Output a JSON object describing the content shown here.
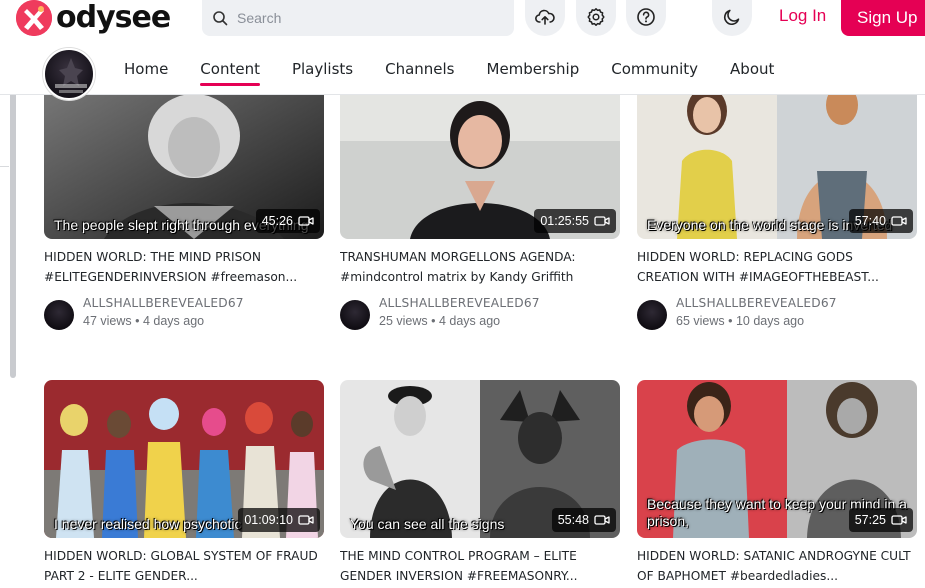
{
  "header": {
    "logo_text": "odysee",
    "search_placeholder": "Search",
    "login_label": "Log In",
    "signup_label": "Sign Up",
    "icons": [
      "upload-icon",
      "settings-icon",
      "help-icon",
      "dark-mode-icon"
    ],
    "accent_color": "#e50054"
  },
  "channel": {
    "tabs": [
      {
        "label": "Home"
      },
      {
        "label": "Content",
        "active": true
      },
      {
        "label": "Playlists"
      },
      {
        "label": "Channels"
      },
      {
        "label": "Membership"
      },
      {
        "label": "Community"
      },
      {
        "label": "About"
      }
    ]
  },
  "videos": [
    {
      "caption": "The people slept right through everything",
      "duration": "45:26",
      "title": "HIDDEN WORLD: THE MIND PRISON #ELITEGENDERINVERSION #freemason...",
      "channel": "ALLSHALLBEREVEALED67",
      "views": "47 views",
      "age": "4 days ago"
    },
    {
      "caption": "",
      "duration": "01:25:55",
      "title": "TRANSHUMAN MORGELLONS AGENDA: #mindcontrol matrix by Kandy Griffith",
      "channel": "ALLSHALLBEREVEALED67",
      "views": "25 views",
      "age": "4 days ago"
    },
    {
      "caption": "Everyone on the world stage is inverted",
      "duration": "57:40",
      "title": "HIDDEN WORLD: REPLACING GODS CREATION WITH #IMAGEOFTHEBEAST...",
      "channel": "ALLSHALLBEREVEALED67",
      "views": "65 views",
      "age": "10 days ago"
    },
    {
      "caption": "I never realised how psychotic",
      "duration": "01:09:10",
      "title": "HIDDEN WORLD: GLOBAL SYSTEM OF FRAUD PART 2 - ELITE GENDER...",
      "channel": "",
      "views": "",
      "age": ""
    },
    {
      "caption": "You can see all the signs",
      "duration": "55:48",
      "title": "THE MIND CONTROL PROGRAM – ELITE GENDER INVERSION #FREEMASONRY...",
      "channel": "",
      "views": "",
      "age": ""
    },
    {
      "caption": "Because they want to keep your mind in a prison,",
      "duration": "57:25",
      "title": "HIDDEN WORLD: SATANIC ANDROGYNE CULT OF BAPHOMET #beardedladies...",
      "channel": "",
      "views": "",
      "age": ""
    }
  ]
}
